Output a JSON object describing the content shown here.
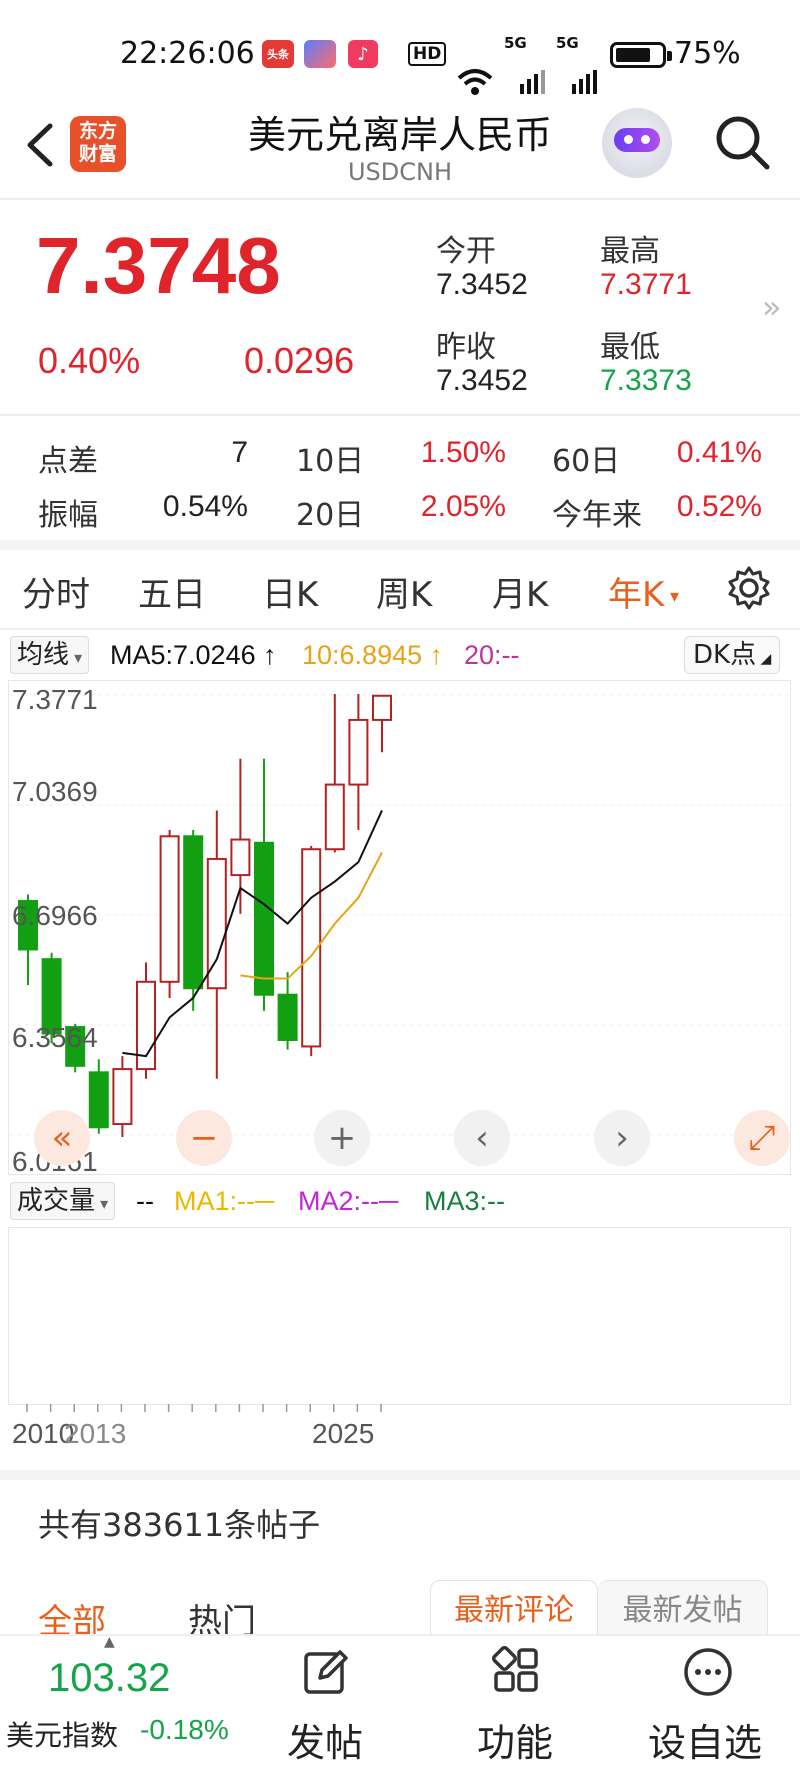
{
  "status_bar": {
    "time": "22:26:06",
    "app_badge": "头条",
    "net_hd": "HD",
    "net_5g_1": "5G",
    "net_5g_2": "5G",
    "battery": "75%"
  },
  "header": {
    "back_icon": "back-arrow-icon",
    "logo_text": "东方财富",
    "title": "美元兑离岸人民币",
    "subtitle": "USDCNH",
    "search_icon": "search-icon"
  },
  "quote": {
    "price": "7.3748",
    "change_pct": "0.40%",
    "change_abs": "0.0296",
    "open_label": "今开",
    "open": "7.3452",
    "high_label": "最高",
    "high": "7.3771",
    "prev_close_label": "昨收",
    "prev_close": "7.3452",
    "low_label": "最低",
    "low": "7.3373",
    "more_icon": "»"
  },
  "stats": [
    {
      "label": "点差",
      "value": "7",
      "color": "#222"
    },
    {
      "label": "10日",
      "value": "1.50%",
      "color": "#e0242b"
    },
    {
      "label": "60日",
      "value": "0.41%",
      "color": "#e0242b"
    },
    {
      "label": "振幅",
      "value": "0.54%",
      "color": "#222"
    },
    {
      "label": "20日",
      "value": "2.05%",
      "color": "#e0242b"
    },
    {
      "label": "今年来",
      "value": "0.52%",
      "color": "#e0242b"
    }
  ],
  "tabs": [
    "分时",
    "五日",
    "日K",
    "周K",
    "月K",
    "年K"
  ],
  "active_tab": "年K",
  "ma_bar": {
    "selector": "均线",
    "ma5": "MA5:7.0246",
    "ma10": "10:6.8945",
    "ma20": "20:--",
    "dk": "DK点"
  },
  "chart_data": {
    "type": "candlestick",
    "y_ticks": [
      "7.3771",
      "7.0369",
      "6.6966",
      "6.3564",
      "6.0161"
    ],
    "ylim": [
      6.0161,
      7.3771
    ],
    "x_labels": [
      "2010",
      "2013",
      "2025"
    ],
    "candles": [
      {
        "o": 6.74,
        "c": 6.59,
        "h": 6.76,
        "l": 6.48
      },
      {
        "o": 6.56,
        "c": 6.33,
        "h": 6.58,
        "l": 6.3
      },
      {
        "o": 6.35,
        "c": 6.23,
        "h": 6.36,
        "l": 6.21
      },
      {
        "o": 6.21,
        "c": 6.04,
        "h": 6.25,
        "l": 6.02
      },
      {
        "o": 6.05,
        "c": 6.22,
        "h": 6.26,
        "l": 6.01
      },
      {
        "o": 6.22,
        "c": 6.49,
        "h": 6.55,
        "l": 6.19
      },
      {
        "o": 6.49,
        "c": 6.94,
        "h": 6.96,
        "l": 6.44
      },
      {
        "o": 6.94,
        "c": 6.47,
        "h": 6.96,
        "l": 6.4
      },
      {
        "o": 6.47,
        "c": 6.87,
        "h": 7.02,
        "l": 6.19
      },
      {
        "o": 6.82,
        "c": 6.93,
        "h": 7.18,
        "l": 6.7
      },
      {
        "o": 6.92,
        "c": 6.45,
        "h": 7.18,
        "l": 6.4
      },
      {
        "o": 6.45,
        "c": 6.31,
        "h": 6.52,
        "l": 6.28
      },
      {
        "o": 6.29,
        "c": 6.9,
        "h": 6.91,
        "l": 6.26
      },
      {
        "o": 6.9,
        "c": 7.1,
        "h": 7.38,
        "l": 6.89
      },
      {
        "o": 7.1,
        "c": 7.3,
        "h": 7.38,
        "l": 6.96
      },
      {
        "o": 7.3,
        "c": 7.3748,
        "h": 7.3771,
        "l": 7.2
      }
    ],
    "ma5_values": [
      null,
      null,
      null,
      null,
      6.27,
      6.26,
      6.38,
      6.44,
      6.56,
      6.78,
      6.73,
      6.67,
      6.75,
      6.8,
      6.86,
      7.02
    ],
    "ma10_values": [
      null,
      null,
      null,
      null,
      null,
      null,
      null,
      null,
      null,
      6.51,
      6.5,
      6.5,
      6.57,
      6.67,
      6.75,
      6.89
    ],
    "ma5_color": "#111111",
    "ma10_color": "#e8a317",
    "up_color": "#b22222",
    "down_color": "#12a012"
  },
  "controls": [
    "«",
    "−",
    "+",
    "‹",
    "›",
    "⤢"
  ],
  "volume_bar": {
    "selector": "成交量",
    "dashes": "--",
    "ma1": "MA1:--",
    "ma2": "MA2:--",
    "ma3": "MA3:--"
  },
  "posts_count": "共有383611条帖子",
  "feed_tabs": {
    "all": "全部",
    "hot": "热门",
    "latest_comment": "最新评论",
    "latest_post": "最新发帖"
  },
  "bottom": {
    "index_value": "103.32",
    "index_label": "美元指数",
    "index_change": "-0.18%",
    "nav": [
      "发帖",
      "功能",
      "设自选"
    ]
  }
}
